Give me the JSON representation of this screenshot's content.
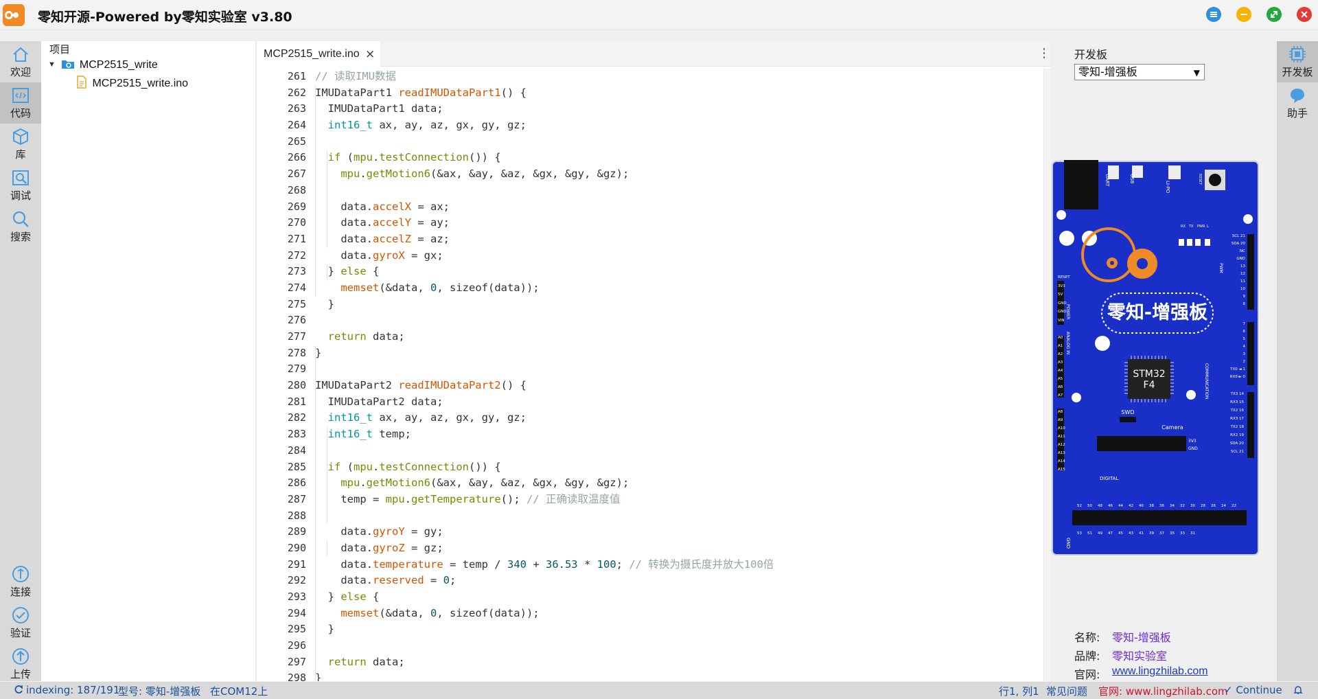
{
  "title": "零知开源-Powered by零知实验室 v3.80",
  "left_nav": [
    {
      "label": "欢迎",
      "icon": "home-icon"
    },
    {
      "label": "代码",
      "icon": "code-icon"
    },
    {
      "label": "库",
      "icon": "cube-icon"
    },
    {
      "label": "调试",
      "icon": "debug-icon"
    },
    {
      "label": "搜索",
      "icon": "search-icon"
    }
  ],
  "left_nav_bottom": [
    {
      "label": "连接",
      "icon": "connect-icon"
    },
    {
      "label": "验证",
      "icon": "check-icon"
    },
    {
      "label": "上传",
      "icon": "upload-icon"
    }
  ],
  "project": {
    "header": "项目",
    "folder": "MCP2515_write",
    "file": "MCP2515_write.ino"
  },
  "editor": {
    "tab_label": "MCP2515_write.ino",
    "close_glyph": "×",
    "kebab_glyph": "⋮"
  },
  "board_panel": {
    "header": "开发板",
    "selected": "零知-增强板",
    "name_label": "名称:",
    "name_value": "零知-增强板",
    "brand_label": "品牌:",
    "brand_value": "零知实验室",
    "site_label": "官网:",
    "site_value": "www.lingzhilab.com"
  },
  "board_image": {
    "board_title": "零知-增强板",
    "chip_line1": "STM32",
    "chip_line2": "F4",
    "uart": "UART",
    "usb": "USB",
    "lipo": "LI-PO",
    "reset": "RESET",
    "swd": "SWD",
    "camera": "Camera",
    "digital": "DIGITAL",
    "pwm": "PWM",
    "power": "POWER",
    "analog": "ANALOG IN",
    "communication": "COMMUNICATION",
    "gnd": "GND",
    "led_labels": [
      "RX",
      "TX",
      "PWR",
      "L"
    ],
    "power_pins": [
      "RESET",
      "3V3",
      "5V",
      "GND",
      "GND",
      "VIN"
    ],
    "analog_pins": [
      "A0",
      "A1",
      "A2",
      "A3",
      "A4",
      "A5",
      "A6",
      "A7"
    ],
    "analog_pins2": [
      "A8",
      "A9",
      "A10",
      "A11",
      "A12",
      "A13",
      "A14",
      "A15"
    ],
    "right_top_pins": [
      "SCL 21",
      "SDA 20",
      "NC",
      "GND",
      "13",
      "12",
      "11",
      "10",
      "9",
      "8"
    ],
    "right_mid_pins": [
      "7",
      "6",
      "5",
      "4",
      "3",
      "2",
      "TX0 ◄ 1",
      "RX0 ► 0"
    ],
    "comm_pins": [
      "TX3 14",
      "RX3 15",
      "TX2 16",
      "RX3 17",
      "TX2 18",
      "RX2 19",
      "SDA 20",
      "SCL 21"
    ],
    "camera_pins": [
      "3V3",
      "GND"
    ],
    "digital_top": [
      "52",
      "50",
      "48",
      "46",
      "44",
      "42",
      "40",
      "38",
      "36",
      "34",
      "32",
      "30",
      "28",
      "26",
      "24",
      "22"
    ],
    "digital_bottom": [
      "53",
      "51",
      "49",
      "47",
      "45",
      "43",
      "41",
      "39",
      "37",
      "35",
      "33",
      "31"
    ]
  },
  "right_nav": [
    {
      "label": "开发板",
      "icon": "board-icon"
    },
    {
      "label": "助手",
      "icon": "assistant-icon"
    }
  ],
  "status": {
    "indexing": "indexing: 187/191",
    "model": "型号: 零知-增强板",
    "port": "在COM12上",
    "position": "行1, 列1",
    "faq": "常见问题",
    "site": "官网: www.lingzhilab.com",
    "continue": "✓ Continue"
  },
  "code": {
    "line_numbers": [
      "261",
      "262",
      "263",
      "264",
      "265",
      "266",
      "267",
      "268",
      "269",
      "270",
      "271",
      "272",
      "273",
      "274",
      "275",
      "276",
      "277",
      "278",
      "279",
      "280",
      "281",
      "282",
      "283",
      "284",
      "285",
      "286",
      "287",
      "288",
      "289",
      "290",
      "291",
      "292",
      "293",
      "294",
      "295",
      "296",
      "297",
      "298"
    ],
    "lines": [
      [
        [
          "c",
          "// 读取IMU数据"
        ]
      ],
      [
        [
          "p",
          "IMUDataPart1 "
        ],
        [
          "f",
          "readIMUDataPart1"
        ],
        [
          "p",
          "() {"
        ]
      ],
      [
        [
          "p",
          "  IMUDataPart1 data;"
        ]
      ],
      [
        [
          "p",
          "  "
        ],
        [
          "t",
          "int16_t"
        ],
        [
          "p",
          " ax, ay, az, gx, gy, gz;"
        ]
      ],
      [],
      [
        [
          "p",
          "  "
        ],
        [
          "k",
          "if"
        ],
        [
          "p",
          " ("
        ],
        [
          "k",
          "mpu"
        ],
        [
          "p",
          "."
        ],
        [
          "k",
          "testConnection"
        ],
        [
          "p",
          "()) {"
        ]
      ],
      [
        [
          "p",
          "    "
        ],
        [
          "k",
          "mpu"
        ],
        [
          "p",
          "."
        ],
        [
          "k",
          "getMotion6"
        ],
        [
          "p",
          "(&ax, &ay, &az, &gx, &gy, &gz);"
        ]
      ],
      [],
      [
        [
          "p",
          "    data."
        ],
        [
          "f",
          "accelX"
        ],
        [
          "p",
          " = ax;"
        ]
      ],
      [
        [
          "p",
          "    data."
        ],
        [
          "f",
          "accelY"
        ],
        [
          "p",
          " = ay;"
        ]
      ],
      [
        [
          "p",
          "    data."
        ],
        [
          "f",
          "accelZ"
        ],
        [
          "p",
          " = az;"
        ]
      ],
      [
        [
          "p",
          "    data."
        ],
        [
          "f",
          "gyroX"
        ],
        [
          "p",
          " = gx;"
        ]
      ],
      [
        [
          "p",
          "  } "
        ],
        [
          "k",
          "else"
        ],
        [
          "p",
          " {"
        ]
      ],
      [
        [
          "p",
          "    "
        ],
        [
          "f",
          "memset"
        ],
        [
          "p",
          "(&data, "
        ],
        [
          "n",
          "0"
        ],
        [
          "p",
          ", sizeof(data));"
        ]
      ],
      [
        [
          "p",
          "  }"
        ]
      ],
      [],
      [
        [
          "p",
          "  "
        ],
        [
          "k",
          "return"
        ],
        [
          "p",
          " data;"
        ]
      ],
      [
        [
          "p",
          "}"
        ]
      ],
      [],
      [
        [
          "p",
          "IMUDataPart2 "
        ],
        [
          "f",
          "readIMUDataPart2"
        ],
        [
          "p",
          "() {"
        ]
      ],
      [
        [
          "p",
          "  IMUDataPart2 data;"
        ]
      ],
      [
        [
          "p",
          "  "
        ],
        [
          "t",
          "int16_t"
        ],
        [
          "p",
          " ax, ay, az, gx, gy, gz;"
        ]
      ],
      [
        [
          "p",
          "  "
        ],
        [
          "t",
          "int16_t"
        ],
        [
          "p",
          " temp;"
        ]
      ],
      [],
      [
        [
          "p",
          "  "
        ],
        [
          "k",
          "if"
        ],
        [
          "p",
          " ("
        ],
        [
          "k",
          "mpu"
        ],
        [
          "p",
          "."
        ],
        [
          "k",
          "testConnection"
        ],
        [
          "p",
          "()) {"
        ]
      ],
      [
        [
          "p",
          "    "
        ],
        [
          "k",
          "mpu"
        ],
        [
          "p",
          "."
        ],
        [
          "k",
          "getMotion6"
        ],
        [
          "p",
          "(&ax, &ay, &az, &gx, &gy, &gz);"
        ]
      ],
      [
        [
          "p",
          "    temp = "
        ],
        [
          "k",
          "mpu"
        ],
        [
          "p",
          "."
        ],
        [
          "k",
          "getTemperature"
        ],
        [
          "p",
          "(); "
        ],
        [
          "c",
          "// 正确读取温度值"
        ]
      ],
      [],
      [
        [
          "p",
          "    data."
        ],
        [
          "f",
          "gyroY"
        ],
        [
          "p",
          " = gy;"
        ]
      ],
      [
        [
          "p",
          "    data."
        ],
        [
          "f",
          "gyroZ"
        ],
        [
          "p",
          " = gz;"
        ]
      ],
      [
        [
          "p",
          "    data."
        ],
        [
          "f",
          "temperature"
        ],
        [
          "p",
          " = temp / "
        ],
        [
          "n",
          "340"
        ],
        [
          "p",
          " + "
        ],
        [
          "n",
          "36.53"
        ],
        [
          "p",
          " * "
        ],
        [
          "n",
          "100"
        ],
        [
          "p",
          "; "
        ],
        [
          "c",
          "// 转换为摄氏度并放大100倍"
        ]
      ],
      [
        [
          "p",
          "    data."
        ],
        [
          "f",
          "reserved"
        ],
        [
          "p",
          " = "
        ],
        [
          "n",
          "0"
        ],
        [
          "p",
          ";"
        ]
      ],
      [
        [
          "p",
          "  } "
        ],
        [
          "k",
          "else"
        ],
        [
          "p",
          " {"
        ]
      ],
      [
        [
          "p",
          "    "
        ],
        [
          "f",
          "memset"
        ],
        [
          "p",
          "(&data, "
        ],
        [
          "n",
          "0"
        ],
        [
          "p",
          ", sizeof(data));"
        ]
      ],
      [
        [
          "p",
          "  }"
        ]
      ],
      [],
      [
        [
          "p",
          "  "
        ],
        [
          "k",
          "return"
        ],
        [
          "p",
          " data;"
        ]
      ],
      [
        [
          "p",
          "}"
        ]
      ]
    ]
  }
}
